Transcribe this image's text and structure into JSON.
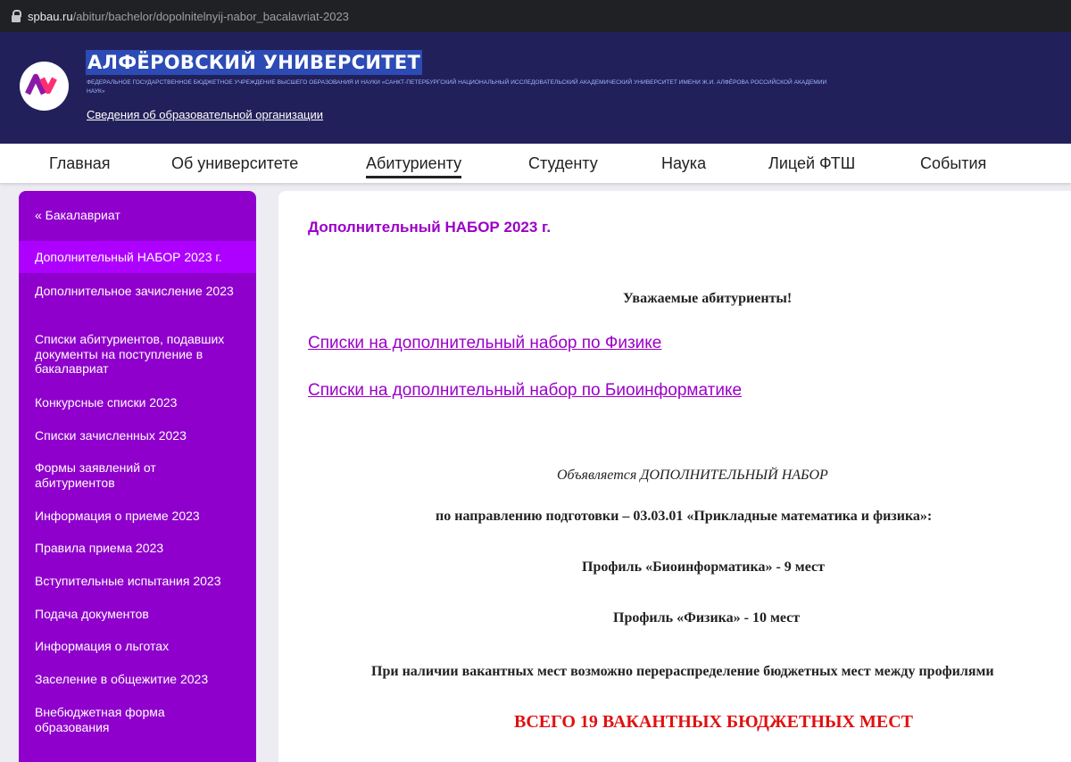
{
  "browser": {
    "url_host": "spbau.ru",
    "url_path": "/abitur/bachelor/dopolnitelnyij-nabor_bacalavriat-2023"
  },
  "header": {
    "logo_text": "AY",
    "title": "АЛФЁРОВСКИЙ УНИВЕРСИТЕТ",
    "org_name": "ФЕДЕРАЛЬНОЕ ГОСУДАРСТВЕННОЕ БЮДЖЕТНОЕ УЧРЕЖДЕНИЕ ВЫСШЕГО ОБРАЗОВАНИЯ И НАУКИ «САНКТ-ПЕТЕРБУРГСКИЙ НАЦИОНАЛЬНЫЙ ИССЛЕДОВАТЕЛЬСКИЙ АКАДЕМИЧЕСКИЙ УНИВЕРСИТЕТ ИМЕНИ Ж.И. АЛФЁРОВА РОССИЙСКОЙ АКАДЕМИИ НАУК»",
    "org_info_link": "Сведения об образовательной организации"
  },
  "nav": {
    "items": [
      "Главная",
      "Об университете",
      "Абитуриенту",
      "Студенту",
      "Наука",
      "Лицей ФТШ",
      "События"
    ],
    "active": "Абитуриенту"
  },
  "sidebar": {
    "back": "« Бакалавриат",
    "items": [
      "Дополнительный НАБОР 2023 г.",
      "Дополнительное зачисление 2023",
      "Списки абитуриентов, подавших документы на поступление в бакалавриат",
      "Конкурсные списки 2023",
      "Списки зачисленных 2023",
      "Формы заявлений от абитуриентов",
      "Информация о приеме 2023",
      "Правила приема 2023",
      "Вступительные испытания 2023",
      "Подача документов",
      "Информация о льготах",
      "Заселение в общежитие 2023",
      "Внебюджетная форма образования"
    ],
    "active_index": 0
  },
  "content": {
    "title": "Дополнительный НАБОР 2023 г.",
    "greeting": "Уважаемые абитуриенты!",
    "link_physics": "Списки на дополнительный набор по Физике",
    "link_bio": "Списки на дополнительный набор по Биоинформатике",
    "announcement": "Объявляется ДОПОЛНИТЕЛЬНЫЙ НАБОР",
    "direction": "по направлению подготовки – 03.03.01  «Прикладные математика и физика»:",
    "profile_bio": "Профиль «Биоинформатика» - 9 мест",
    "profile_phys": "Профиль «Физика» - 10 мест",
    "reallocation": "При наличии вакантных мест возможно перераспределение бюджетных мест между профилями",
    "total": "ВСЕГО 19 ВАКАНТНЫХ БЮДЖЕТНЫХ МЕСТ"
  },
  "colors": {
    "header_bg": "#22205a",
    "sidebar_bg": "#8f00cc",
    "sidebar_active": "#ae00ff",
    "accent_purple": "#9b00c8",
    "alert_red": "#e01010"
  }
}
